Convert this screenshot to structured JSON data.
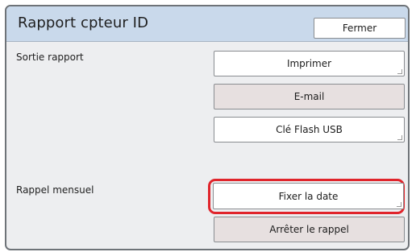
{
  "dialog": {
    "title": "Rapport cpteur ID",
    "close_label": "Fermer"
  },
  "output": {
    "label": "Sortie rapport",
    "buttons": [
      {
        "label": "Imprimer",
        "enabled": true
      },
      {
        "label": "E-mail",
        "enabled": false
      },
      {
        "label": "Clé Flash USB",
        "enabled": true
      }
    ]
  },
  "reminder": {
    "label": "Rappel mensuel",
    "buttons": [
      {
        "label": "Fixer la date",
        "enabled": true,
        "highlighted": true
      },
      {
        "label": "Arrêter le rappel",
        "enabled": false
      }
    ]
  },
  "colors": {
    "header": "#c9d9eb",
    "panel": "#edeef0",
    "disabled_button": "#e7e0e0",
    "highlight": "#e0242b"
  }
}
